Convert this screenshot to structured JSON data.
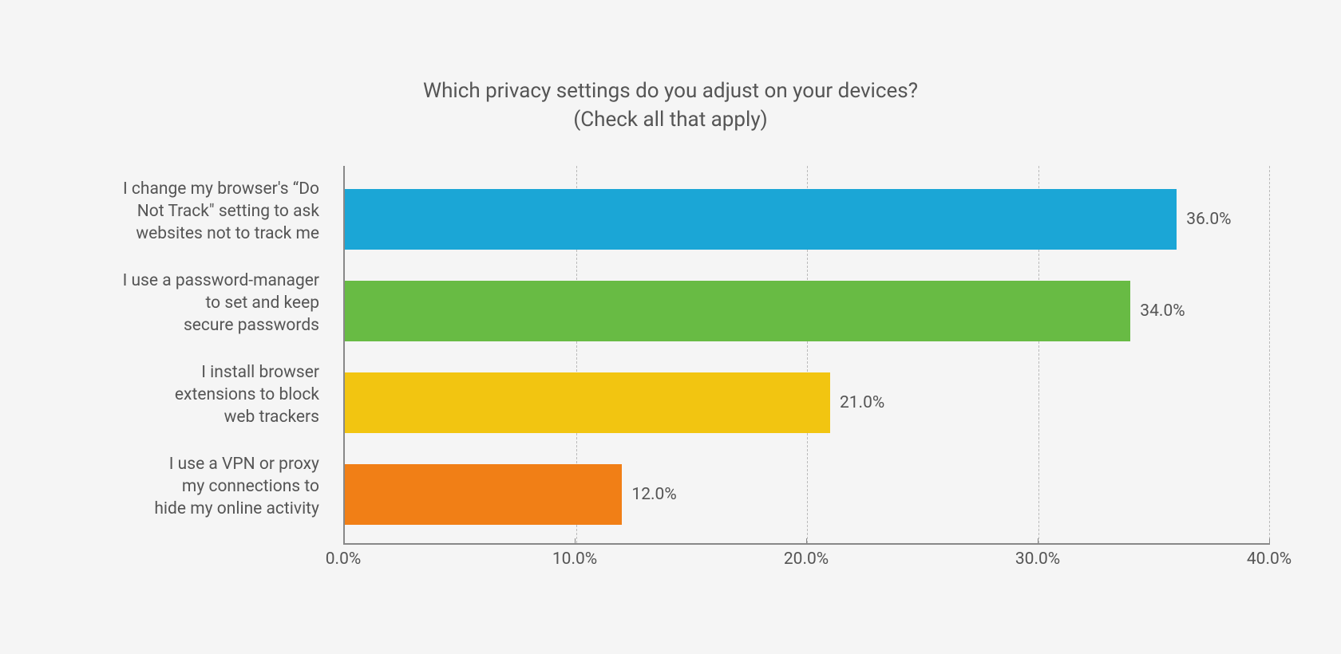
{
  "chart_data": {
    "type": "bar",
    "orientation": "horizontal",
    "title": "Which privacy settings do you adjust on your devices?\n(Check all that apply)",
    "categories": [
      "I change my browser's “Do Not Track\" setting to ask websites not to track me",
      "I use a password-manager to set and keep secure passwords",
      "I install browser extensions to block web trackers",
      "I use a VPN or proxy my connections to hide my online activity"
    ],
    "values": [
      36.0,
      34.0,
      21.0,
      12.0
    ],
    "value_labels": [
      "36.0%",
      "34.0%",
      "21.0%",
      "12.0%"
    ],
    "colors": [
      "#1ba6d6",
      "#68bb44",
      "#f2c511",
      "#f17f16"
    ],
    "xlim": [
      0,
      40
    ],
    "xticks": [
      0,
      10,
      20,
      30,
      40
    ],
    "xtick_labels": [
      "0.0%",
      "10.0%",
      "20.0%",
      "30.0%",
      "40.0%"
    ],
    "xlabel": "",
    "ylabel": ""
  },
  "category_lines": [
    [
      "I change my browser's “Do",
      "Not Track\" setting to ask",
      "websites not to track me"
    ],
    [
      "I use a password-manager",
      "to set and keep",
      "secure passwords"
    ],
    [
      "I install browser",
      "extensions to block",
      "web trackers"
    ],
    [
      "I use a VPN or proxy",
      "my connections to",
      "hide my online activity"
    ]
  ]
}
